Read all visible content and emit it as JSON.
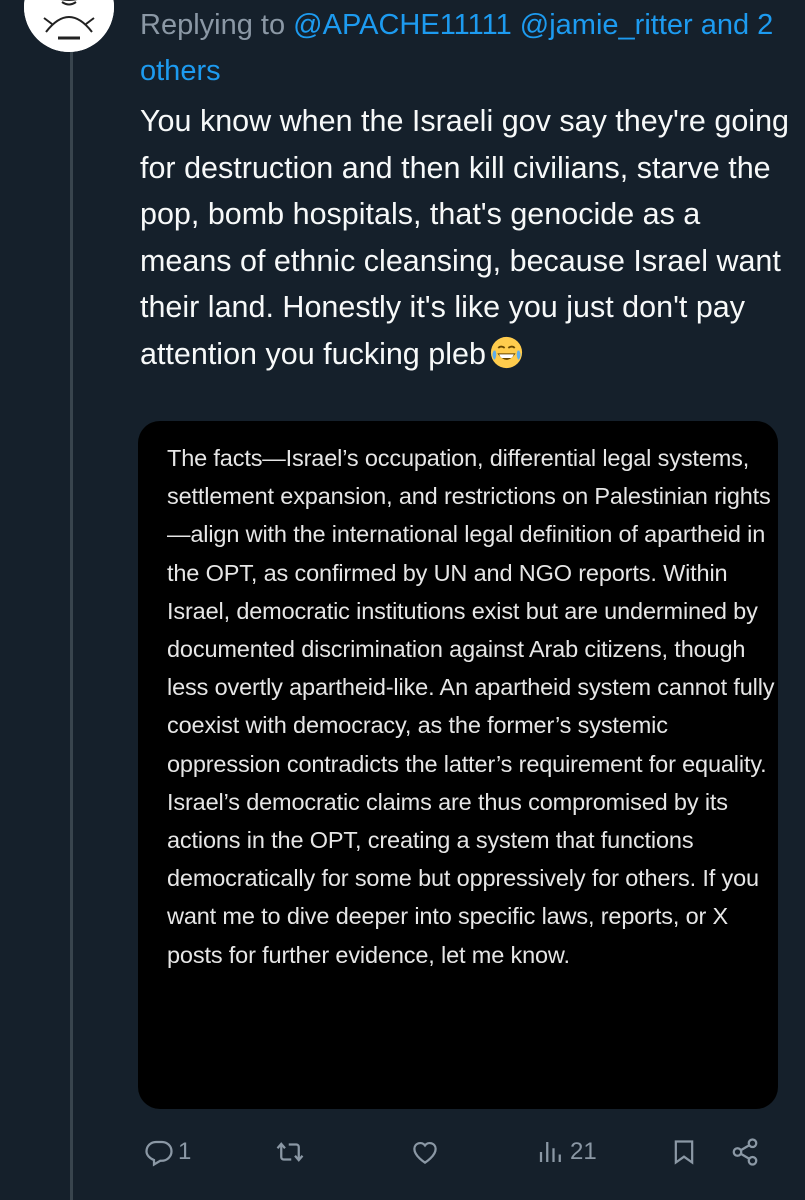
{
  "reply_header": {
    "prefix": "Replying to",
    "handles": [
      "@APACHE11111",
      "@jamie_ritter"
    ],
    "others": "and 2 others"
  },
  "tweet": {
    "text": "You know when the Israeli gov say they're going for destruction and then kill civilians, starve the pop, bomb hospitals, that's genocide as a means of ethnic cleansing, because Israel want their land. Honestly it's like you just don't pay attention you fucking pleb",
    "emoji": "face-with-tears-of-joy"
  },
  "media": {
    "text": "The facts—Israel’s occupation, differential legal systems, settlement expansion, and restrictions on Palestinian rights—align with the international legal definition of apartheid in the OPT, as confirmed by UN and NGO reports. Within Israel, democratic institutions exist but are undermined by documented discrimination against Arab citizens, though less overtly apartheid-like. An apartheid system cannot fully coexist with democracy, as the former’s systemic oppression contradicts the latter’s requirement for equality. Israel’s democratic claims are thus compromised by its actions in the OPT, creating a system that functions democratically for some but oppressively for others. If you want me to dive deeper into specific laws, reports, or X posts for further evidence, let me know."
  },
  "actions": {
    "reply_count": "1",
    "views_count": "21"
  },
  "colors": {
    "background": "#15202b",
    "text": "#f7f9f9",
    "secondary": "#8b98a5",
    "link": "#1d9bf0",
    "thread_line": "#38444d",
    "media_background": "#000000"
  },
  "icons": [
    "avatar-image",
    "reply-icon",
    "retweet-icon",
    "like-icon",
    "views-icon",
    "bookmark-icon",
    "share-icon",
    "laughing-emoji-icon"
  ]
}
